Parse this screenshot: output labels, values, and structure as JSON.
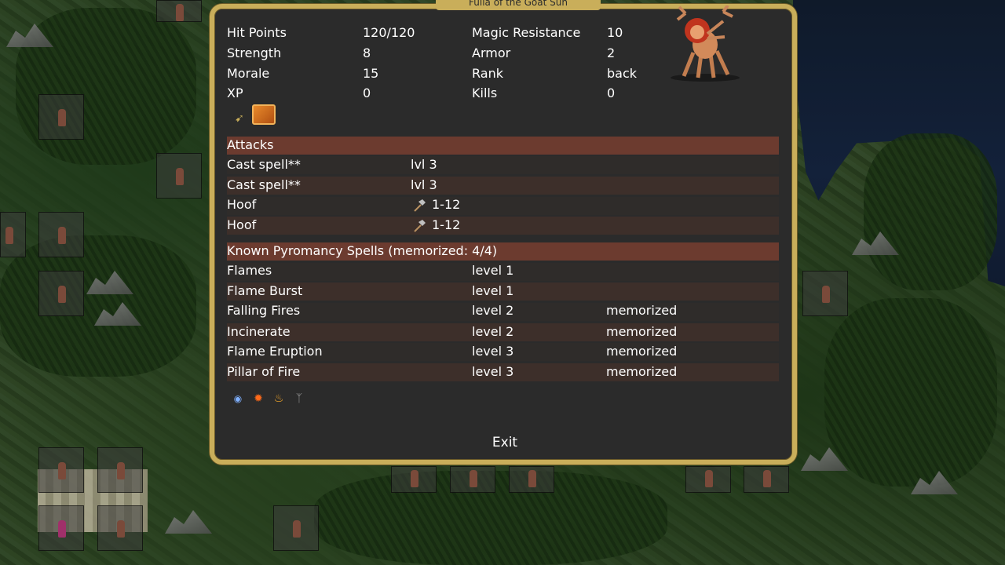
{
  "dialog": {
    "title": "Fulla of the Goat Sun",
    "stats": [
      {
        "label": "Hit Points",
        "value": "120/120",
        "label2": "Magic Resistance",
        "value2": "10"
      },
      {
        "label": "Strength",
        "value": "8",
        "label2": "Armor",
        "value2": "2"
      },
      {
        "label": "Morale",
        "value": "15",
        "label2": "Rank",
        "value2": "back"
      },
      {
        "label": "XP",
        "value": "0",
        "label2": "Kills",
        "value2": "0"
      }
    ],
    "item_icons": [
      "horn-icon",
      "scroll-icon"
    ],
    "attacks_header": "Attacks",
    "attacks": [
      {
        "name": "Cast spell**",
        "value": "lvl 3",
        "icon": ""
      },
      {
        "name": "Cast spell**",
        "value": "lvl 3",
        "icon": ""
      },
      {
        "name": "Hoof",
        "value": "1-12",
        "icon": "hammer-icon"
      },
      {
        "name": "Hoof",
        "value": "1-12",
        "icon": "hammer-icon"
      }
    ],
    "spells_header": "Known Pyromancy Spells (memorized: 4/4)",
    "spells": [
      {
        "name": "Flames",
        "level": "level 1",
        "status": ""
      },
      {
        "name": "Flame Burst",
        "level": "level 1",
        "status": ""
      },
      {
        "name": "Falling Fires",
        "level": "level 2",
        "status": "memorized"
      },
      {
        "name": "Incinerate",
        "level": "level 2",
        "status": "memorized"
      },
      {
        "name": "Flame Eruption",
        "level": "level 3",
        "status": "memorized"
      },
      {
        "name": "Pillar of Fire",
        "level": "level 3",
        "status": "memorized"
      }
    ],
    "ability_icons": [
      "eye-icon",
      "fire-burst-icon",
      "flame-icon",
      "wolf-icon"
    ],
    "exit_label": "Exit"
  },
  "colors": {
    "frame": "#c9ae5a",
    "panel": "#2b2b2b",
    "header_band": "#6c3b2f",
    "row_band": "#3d2f2a",
    "text": "#ffffff"
  }
}
